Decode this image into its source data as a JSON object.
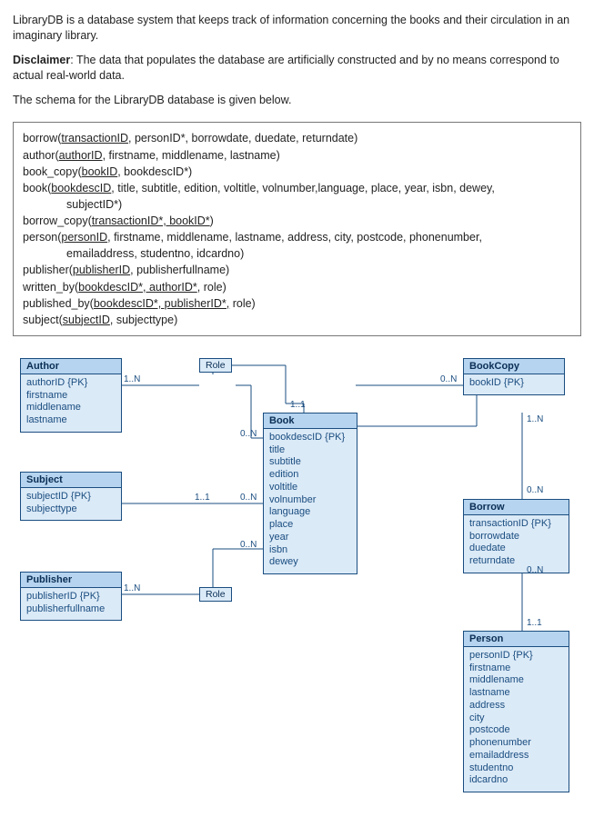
{
  "intro": {
    "p1": "LibraryDB is a database system that keeps track of information concerning the books and their circulation in an imaginary library.",
    "p2_lead": "Disclaimer",
    "p2_rest": ": The data that populates the database are artificially constructed and by no means correspond to actual real-world data.",
    "p3": "The schema for the LibraryDB database is given below."
  },
  "schema": {
    "borrow_a": "borrow(",
    "borrow_u": "transactionID",
    "borrow_b": ", personID*, borrowdate, duedate, returndate)",
    "author_a": "author(",
    "author_u": "authorID",
    "author_b": ", firstname, middlename, lastname)",
    "bookcopy_a": "book_copy(",
    "bookcopy_u": "bookID",
    "bookcopy_b": ", bookdescID*)",
    "book_a": "book(",
    "book_u": "bookdescID",
    "book_b": ", title, subtitle, edition, voltitle, volnumber,language, place, year, isbn, dewey,",
    "book_indent": "subjectID*)",
    "borrowcopy_a": "borrow_copy(",
    "borrowcopy_u": "transactionID*, bookID*",
    "borrowcopy_b": ")",
    "person_a": "person(",
    "person_u": "personID",
    "person_b": ", firstname, middlename, lastname, address, city, postcode, phonenumber,",
    "person_indent": "emailaddress, studentno, idcardno)",
    "publisher_a": "publisher(",
    "publisher_u": "publisherID",
    "publisher_b": ", publisherfullname)",
    "writtenby_a": "written_by(",
    "writtenby_u": "bookdescID*, authorID*",
    "writtenby_b": ", role)",
    "publishedby_a": "published_by(",
    "publishedby_u": "bookdescID*, publisherID*,",
    "publishedby_b": " role)",
    "subject_a": "subject(",
    "subject_u": "subjectID",
    "subject_b": ", subjecttype)"
  },
  "ent": {
    "author": {
      "title": "Author",
      "a1": "authorID {PK}",
      "a2": "firstname",
      "a3": "middlename",
      "a4": "lastname"
    },
    "role1": "Role",
    "role2": "Role",
    "book": {
      "title": "Book",
      "a1": "bookdescID {PK}",
      "a2": "title",
      "a3": "subtitle",
      "a4": "edition",
      "a5": "voltitle",
      "a6": "volnumber",
      "a7": "language",
      "a8": "place",
      "a9": "year",
      "a10": "isbn",
      "a11": "dewey"
    },
    "bookcopy": {
      "title": "BookCopy",
      "a1": "bookID {PK}"
    },
    "subject": {
      "title": "Subject",
      "a1": "subjectID {PK}",
      "a2": "subjecttype"
    },
    "publisher": {
      "title": "Publisher",
      "a1": "publisherID {PK}",
      "a2": "publisherfullname"
    },
    "borrow": {
      "title": "Borrow",
      "a1": "transactionID {PK}",
      "a2": "borrowdate",
      "a3": "duedate",
      "a4": "returndate"
    },
    "person": {
      "title": "Person",
      "a1": "personID {PK}",
      "a2": "firstname",
      "a3": "middlename",
      "a4": "lastname",
      "a5": "address",
      "a6": "city",
      "a7": "postcode",
      "a8": "phonenumber",
      "a9": "emailaddress",
      "a10": "studentno",
      "a11": "idcardno"
    }
  },
  "card": {
    "c1": "1..N",
    "c2": "0..N",
    "c3": "1..1",
    "c4": "0..N",
    "c5": "1..1",
    "c6": "0..N",
    "c7": "1..N",
    "c8": "0..N",
    "c9": "1..N",
    "c10": "0..N",
    "c11": "0..N",
    "c12": "1..1"
  }
}
